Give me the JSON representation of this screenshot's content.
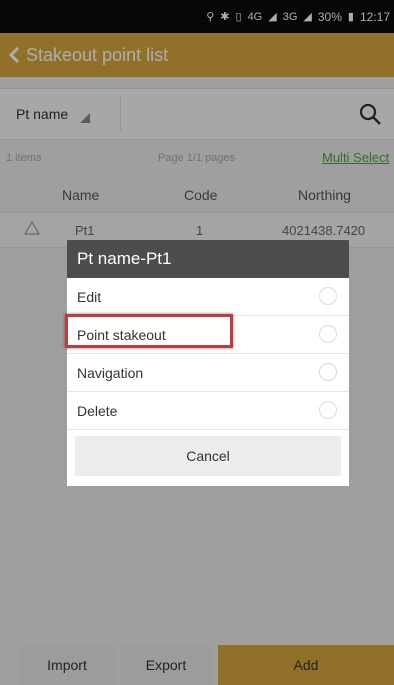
{
  "status_bar": {
    "location_icon": "location-icon",
    "bluetooth_icon": "bluetooth-icon",
    "vibrate_icon": "vibrate-icon",
    "network1": "4G",
    "network2": "3G",
    "battery": "30%",
    "time": "12:17"
  },
  "header": {
    "title": "Stakeout point list",
    "back_icon": "chevron-left-icon"
  },
  "search": {
    "field_label": "Pt name",
    "placeholder": "",
    "search_icon": "search-icon"
  },
  "list_info": {
    "items": "1 items",
    "pages": "Page 1/1 pages",
    "multi_select": "Multi Select"
  },
  "table": {
    "columns": [
      "Name",
      "Code",
      "Northing"
    ],
    "rows": [
      {
        "name": "Pt1",
        "code": "1",
        "northing": "4021438.7420"
      }
    ]
  },
  "dialog": {
    "title": "Pt name-Pt1",
    "options": [
      "Edit",
      "Point stakeout",
      "Navigation",
      "Delete"
    ],
    "cancel_label": "Cancel"
  },
  "footer": {
    "import_label": "Import",
    "export_label": "Export",
    "add_label": "Add"
  },
  "colors": {
    "accent": "#d6a73e",
    "highlight": "#c03b3b",
    "link": "#4aa23a"
  }
}
